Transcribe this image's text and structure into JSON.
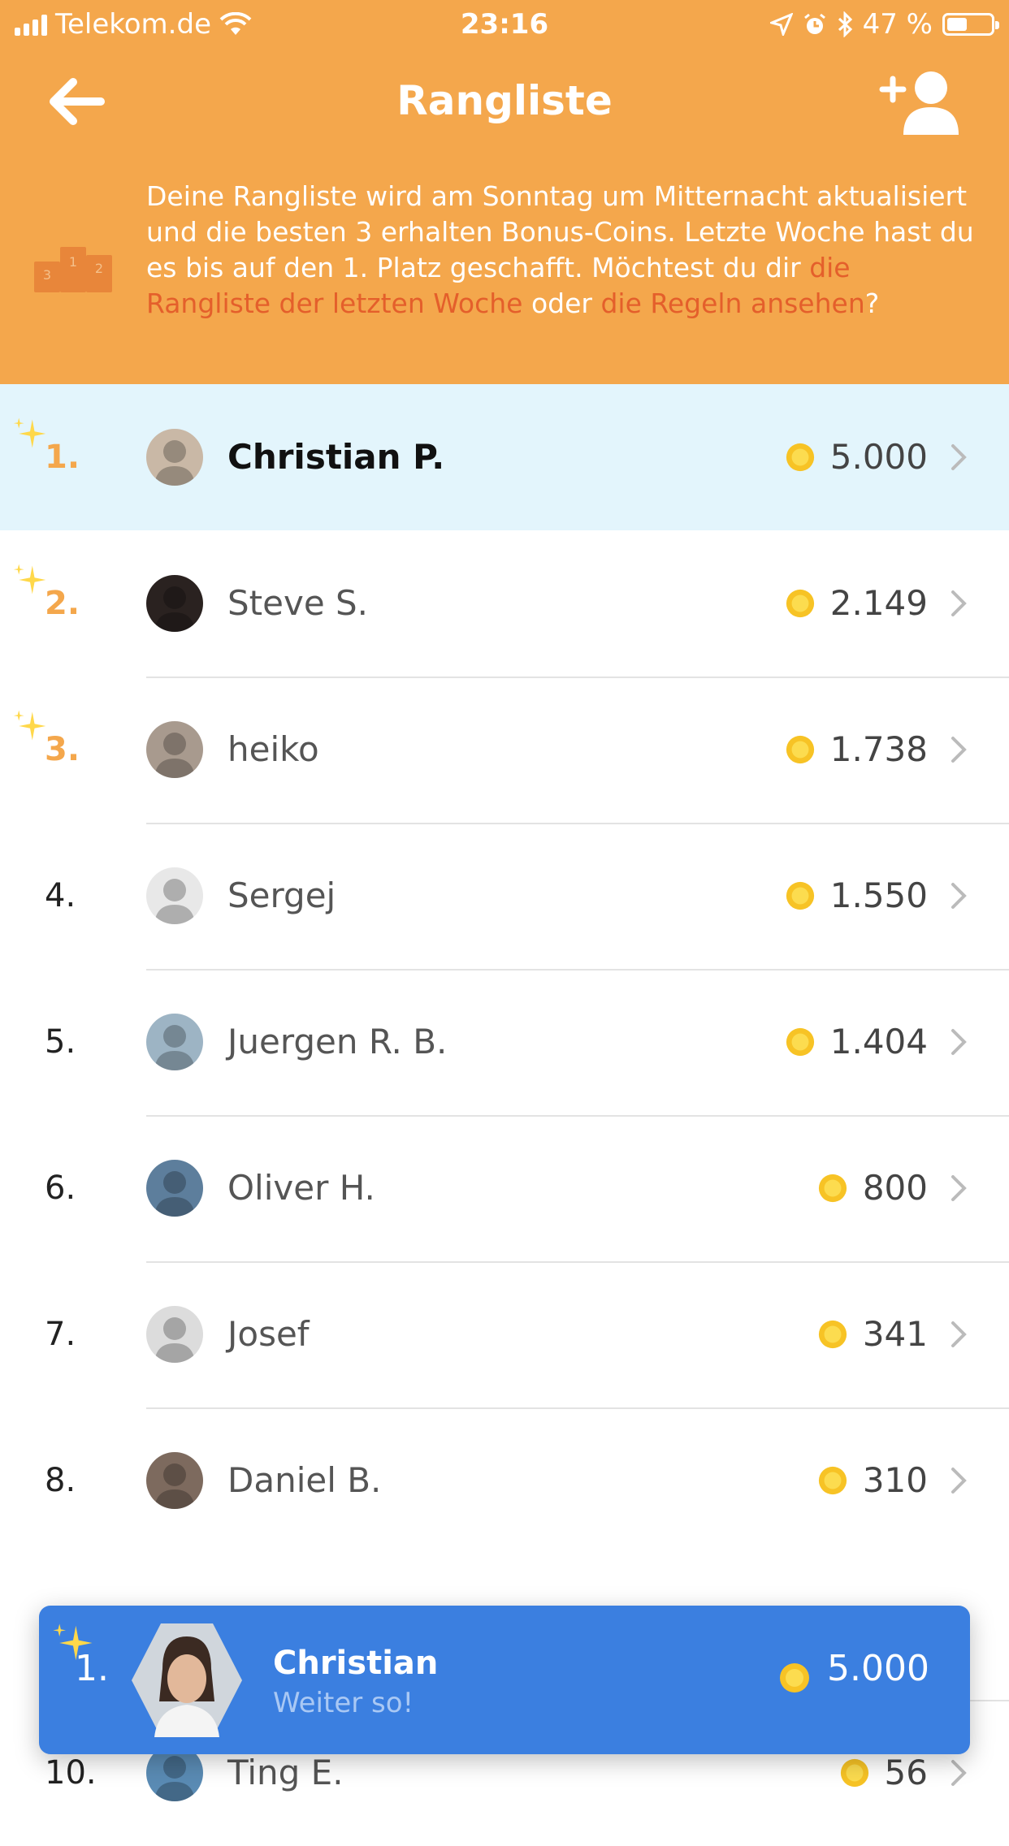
{
  "status_bar": {
    "carrier": "Telekom.de",
    "time": "23:16",
    "battery": "47 %",
    "battery_level": 0.47
  },
  "nav": {
    "title": "Rangliste",
    "back_icon": "arrow-left-icon",
    "add_friend_icon": "add-friend-icon"
  },
  "info": {
    "text_1": "Deine Rangliste wird am Sonntag um Mitternacht aktualisiert und die besten 3 erhalten Bonus-Coins. Letzte Woche hast du es bis auf den 1. Platz geschafft. Möchtest du dir ",
    "link_last_week": "die Rangliste der letzten Woche",
    "text_2": " oder ",
    "link_rules": "die Regeln ansehen",
    "text_3": "?",
    "podium_icon": "podium-icon",
    "podium_numbers": [
      "1",
      "2",
      "3"
    ]
  },
  "colors": {
    "header": "#f4a74c",
    "link": "#e45f2b",
    "highlight_row": "#e3f5fc",
    "card": "#3b7fe0",
    "coin": "#f7c325"
  },
  "leaderboard": [
    {
      "rank": "1.",
      "name": "Christian P.",
      "score": "5.000",
      "me": true,
      "top": true
    },
    {
      "rank": "2.",
      "name": "Steve S.",
      "score": "2.149",
      "me": false,
      "top": true
    },
    {
      "rank": "3.",
      "name": "heiko",
      "score": "1.738",
      "me": false,
      "top": true
    },
    {
      "rank": "4.",
      "name": "Sergej",
      "score": "1.550",
      "me": false,
      "top": false
    },
    {
      "rank": "5.",
      "name": "Juergen R. B.",
      "score": "1.404",
      "me": false,
      "top": false
    },
    {
      "rank": "6.",
      "name": "Oliver H.",
      "score": "800",
      "me": false,
      "top": false
    },
    {
      "rank": "7.",
      "name": "Josef",
      "score": "341",
      "me": false,
      "top": false
    },
    {
      "rank": "8.",
      "name": "Daniel B.",
      "score": "310",
      "me": false,
      "top": false
    },
    {
      "rank": "10.",
      "name": "Ting E.",
      "score": "56",
      "me": false,
      "top": false
    }
  ],
  "my_card": {
    "rank": "1.",
    "name": "Christian",
    "subtitle": "Weiter so!",
    "score": "5.000"
  }
}
